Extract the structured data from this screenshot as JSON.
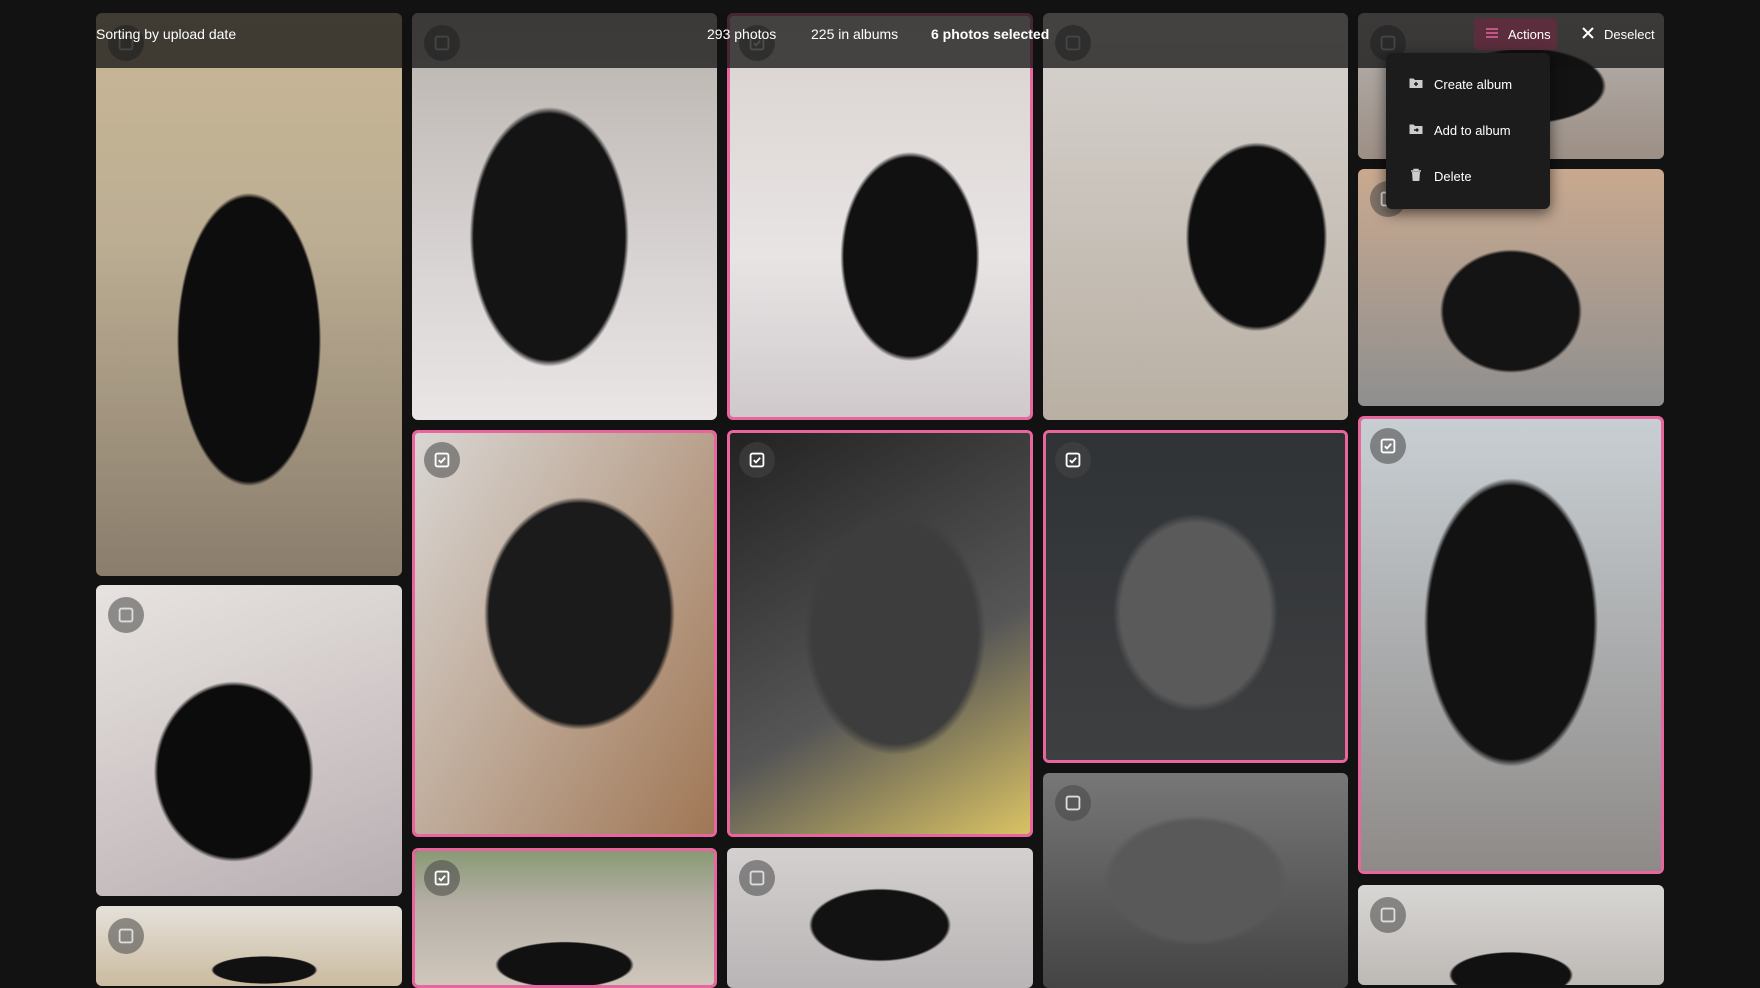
{
  "toolbar": {
    "sort_label": "Sorting by upload date",
    "photo_count": "293 photos",
    "album_count": "225 in albums",
    "selected_count": "6 photos selected",
    "actions_label": "Actions",
    "deselect_label": "Deselect"
  },
  "actions_menu": {
    "items": [
      {
        "label": "Create album",
        "icon": "folder-plus-icon"
      },
      {
        "label": "Add to album",
        "icon": "folder-add-icon"
      },
      {
        "label": "Delete",
        "icon": "trash-icon"
      }
    ]
  },
  "colors": {
    "background": "#121212",
    "selection_border": "#e8659d",
    "actions_button": "#5b2d3d"
  },
  "photos": [
    {
      "id": "photo-1",
      "selected": false
    },
    {
      "id": "photo-2",
      "selected": false
    },
    {
      "id": "photo-3",
      "selected": false
    },
    {
      "id": "photo-4",
      "selected": true
    },
    {
      "id": "photo-5",
      "selected": true
    },
    {
      "id": "photo-6",
      "selected": false
    },
    {
      "id": "photo-7",
      "selected": false
    },
    {
      "id": "photo-8",
      "selected": true
    },
    {
      "id": "photo-9",
      "selected": false
    },
    {
      "id": "photo-10",
      "selected": false
    },
    {
      "id": "photo-11",
      "selected": true
    },
    {
      "id": "photo-12",
      "selected": false
    },
    {
      "id": "photo-13",
      "selected": false
    },
    {
      "id": "photo-14",
      "selected": true
    },
    {
      "id": "photo-15",
      "selected": true
    },
    {
      "id": "photo-16",
      "selected": false
    }
  ]
}
